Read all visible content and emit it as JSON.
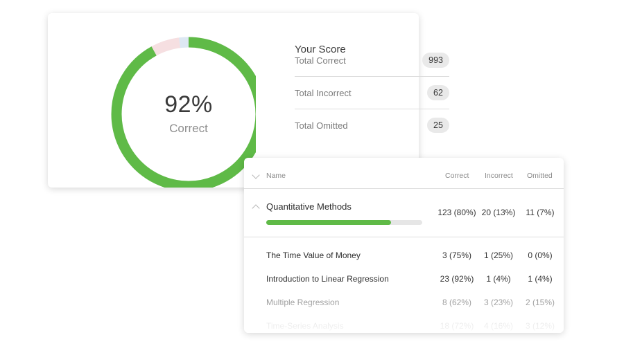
{
  "score": {
    "percent_text": "92%",
    "percent_label": "Correct",
    "title": "Your Score",
    "donut": {
      "correct_fraction": 0.92,
      "incorrect_fraction": 0.06,
      "omitted_fraction": 0.02
    },
    "colors": {
      "correct": "#5fba47",
      "incorrect": "#f6dfe1",
      "omitted": "#dde8f3"
    },
    "stats": [
      {
        "label": "Total Correct",
        "value": "993"
      },
      {
        "label": "Total Incorrect",
        "value": "62"
      },
      {
        "label": "Total Omitted",
        "value": "25"
      }
    ]
  },
  "breakdown": {
    "headers": {
      "name": "Name",
      "correct": "Correct",
      "incorrect": "Incorrect",
      "omitted": "Omitted"
    },
    "section": {
      "name": "Quantitative Methods",
      "correct": "123 (80%)",
      "incorrect": "20 (13%)",
      "omitted": "11 (7%)",
      "progress": 0.8
    },
    "rows": [
      {
        "name": "The Time Value of Money",
        "correct": "3 (75%)",
        "incorrect": "1 (25%)",
        "omitted": "0 (0%)"
      },
      {
        "name": "Introduction to Linear Regression",
        "correct": "23 (92%)",
        "incorrect": "1 (4%)",
        "omitted": "1 (4%)"
      },
      {
        "name": "Multiple Regression",
        "correct": "8 (62%)",
        "incorrect": "3 (23%)",
        "omitted": "2 (15%)"
      },
      {
        "name": "Time-Series Analysis",
        "correct": "18 (72%)",
        "incorrect": "4 (16%)",
        "omitted": "3 (12%)"
      }
    ]
  }
}
